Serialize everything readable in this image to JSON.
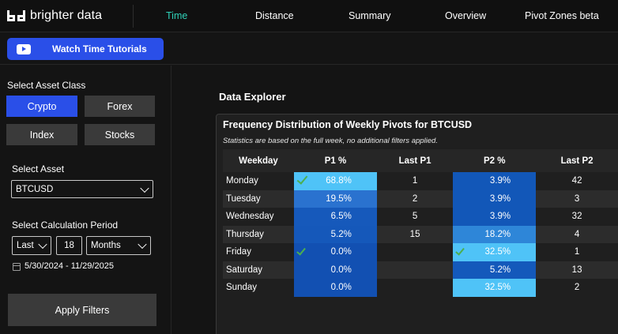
{
  "brand": {
    "name": "brighter data"
  },
  "nav": {
    "tabs": [
      "Time",
      "Distance",
      "Summary",
      "Overview",
      "Pivot Zones beta"
    ],
    "active": "Time"
  },
  "tutorial": {
    "label": "Watch Time Tutorials",
    "icon": "youtube-icon"
  },
  "sidebar": {
    "asset_class_heading": "Select Asset Class",
    "asset_classes": [
      "Crypto",
      "Forex",
      "Index",
      "Stocks"
    ],
    "selected_asset_class": "Crypto",
    "asset_heading": "Select Asset",
    "asset_value": "BTCUSD",
    "period_heading": "Select Calculation Period",
    "period_mode": "Last",
    "period_count": "18",
    "period_unit": "Months",
    "date_range": "5/30/2024 - 11/29/2025",
    "apply_label": "Apply Filters"
  },
  "explorer": {
    "title": "Data Explorer",
    "card_title": "Frequency Distribution of Weekly Pivots for BTCUSD",
    "card_subtitle": "Statistics are based on the full week, no additional filters applied.",
    "columns": [
      "Weekday",
      "P1 %",
      "Last P1",
      "P2 %",
      "Last P2"
    ],
    "rows": [
      {
        "day": "Monday",
        "p1": "68.8%",
        "last_p1": "1",
        "p2": "3.9%",
        "last_p2": "42",
        "p1_check": true,
        "p2_check": false,
        "p1_color": "#4fc3f7",
        "p2_color": "#1257b8"
      },
      {
        "day": "Tuesday",
        "p1": "19.5%",
        "last_p1": "2",
        "p2": "3.9%",
        "last_p2": "3",
        "p1_check": false,
        "p2_check": false,
        "p1_color": "#2a72cf",
        "p2_color": "#1257b8"
      },
      {
        "day": "Wednesday",
        "p1": "6.5%",
        "last_p1": "5",
        "p2": "3.9%",
        "last_p2": "32",
        "p1_check": false,
        "p2_check": false,
        "p1_color": "#1659bb",
        "p2_color": "#1257b8"
      },
      {
        "day": "Thursday",
        "p1": "5.2%",
        "last_p1": "15",
        "p2": "18.2%",
        "last_p2": "4",
        "p1_check": false,
        "p2_check": false,
        "p1_color": "#1558ba",
        "p2_color": "#2e86d8"
      },
      {
        "day": "Friday",
        "p1": "0.0%",
        "last_p1": "",
        "p2": "32.5%",
        "last_p2": "1",
        "p1_check": true,
        "p2_check": true,
        "p1_color": "#1250b2",
        "p2_color": "#4fc3f7"
      },
      {
        "day": "Saturday",
        "p1": "0.0%",
        "last_p1": "",
        "p2": "5.2%",
        "last_p2": "13",
        "p1_check": false,
        "p2_check": false,
        "p1_color": "#1250b2",
        "p2_color": "#1459bb"
      },
      {
        "day": "Sunday",
        "p1": "0.0%",
        "last_p1": "",
        "p2": "32.5%",
        "last_p2": "2",
        "p1_check": false,
        "p2_check": false,
        "p1_color": "#1250b2",
        "p2_color": "#4fc3f7"
      }
    ]
  }
}
